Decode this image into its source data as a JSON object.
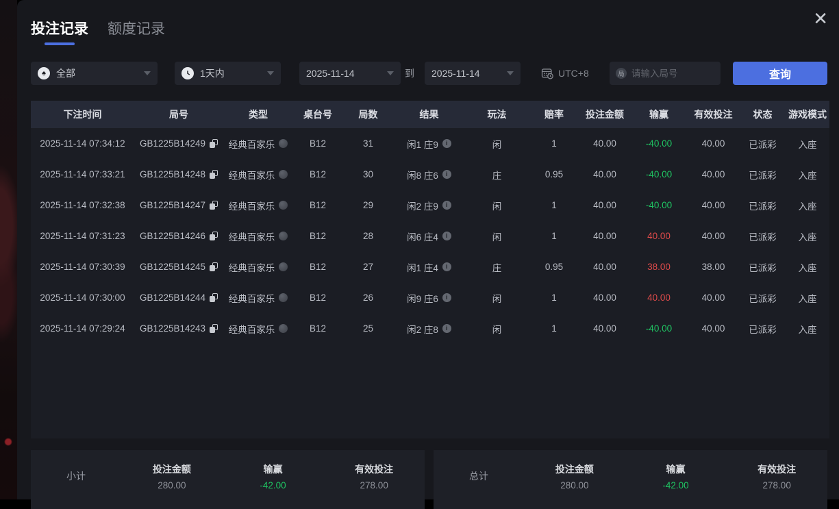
{
  "icons": {
    "close": "✕",
    "round_input_char": "局"
  },
  "colors": {
    "accent_blue": "#4c6fe0",
    "positive_red": "#e04b4b",
    "negative_green": "#1fc462"
  },
  "tabs": [
    {
      "label": "投注记录",
      "active": true
    },
    {
      "label": "额度记录",
      "active": false
    }
  ],
  "filters": {
    "game_type_value": "全部",
    "time_range_value": "1天内",
    "date_from": "2025-11-14",
    "to_label": "到",
    "date_to": "2025-11-14",
    "timezone": "UTC+8",
    "round_input_placeholder": "请输入局号",
    "query_button_label": "查询"
  },
  "table": {
    "headers": [
      "下注时间",
      "局号",
      "类型",
      "桌台号",
      "局数",
      "结果",
      "玩法",
      "赔率",
      "投注金额",
      "输赢",
      "有效投注",
      "状态",
      "游戏模式"
    ],
    "rows": [
      {
        "time": "2025-11-14 07:34:12",
        "round_id": "GB1225B14249",
        "type": "经典百家乐",
        "table_no": "B12",
        "round_no": "31",
        "result": "闲1 庄9",
        "play": "闲",
        "odds": "1",
        "bet": "40.00",
        "win_loss": "-40.00",
        "win_loss_color": "green",
        "valid_bet": "40.00",
        "status": "已派彩",
        "mode": "入座"
      },
      {
        "time": "2025-11-14 07:33:21",
        "round_id": "GB1225B14248",
        "type": "经典百家乐",
        "table_no": "B12",
        "round_no": "30",
        "result": "闲8 庄6",
        "play": "庄",
        "odds": "0.95",
        "bet": "40.00",
        "win_loss": "-40.00",
        "win_loss_color": "green",
        "valid_bet": "40.00",
        "status": "已派彩",
        "mode": "入座"
      },
      {
        "time": "2025-11-14 07:32:38",
        "round_id": "GB1225B14247",
        "type": "经典百家乐",
        "table_no": "B12",
        "round_no": "29",
        "result": "闲2 庄9",
        "play": "闲",
        "odds": "1",
        "bet": "40.00",
        "win_loss": "-40.00",
        "win_loss_color": "green",
        "valid_bet": "40.00",
        "status": "已派彩",
        "mode": "入座"
      },
      {
        "time": "2025-11-14 07:31:23",
        "round_id": "GB1225B14246",
        "type": "经典百家乐",
        "table_no": "B12",
        "round_no": "28",
        "result": "闲6 庄4",
        "play": "闲",
        "odds": "1",
        "bet": "40.00",
        "win_loss": "40.00",
        "win_loss_color": "red",
        "valid_bet": "40.00",
        "status": "已派彩",
        "mode": "入座"
      },
      {
        "time": "2025-11-14 07:30:39",
        "round_id": "GB1225B14245",
        "type": "经典百家乐",
        "table_no": "B12",
        "round_no": "27",
        "result": "闲1 庄4",
        "play": "庄",
        "odds": "0.95",
        "bet": "40.00",
        "win_loss": "38.00",
        "win_loss_color": "red",
        "valid_bet": "38.00",
        "status": "已派彩",
        "mode": "入座"
      },
      {
        "time": "2025-11-14 07:30:00",
        "round_id": "GB1225B14244",
        "type": "经典百家乐",
        "table_no": "B12",
        "round_no": "26",
        "result": "闲9 庄6",
        "play": "闲",
        "odds": "1",
        "bet": "40.00",
        "win_loss": "40.00",
        "win_loss_color": "red",
        "valid_bet": "40.00",
        "status": "已派彩",
        "mode": "入座"
      },
      {
        "time": "2025-11-14 07:29:24",
        "round_id": "GB1225B14243",
        "type": "经典百家乐",
        "table_no": "B12",
        "round_no": "25",
        "result": "闲2 庄8",
        "play": "闲",
        "odds": "1",
        "bet": "40.00",
        "win_loss": "-40.00",
        "win_loss_color": "green",
        "valid_bet": "40.00",
        "status": "已派彩",
        "mode": "入座"
      }
    ]
  },
  "summary": {
    "col_bet": "投注金额",
    "col_win": "输赢",
    "col_valid": "有效投注",
    "subtotal": {
      "label": "小计",
      "bet": "280.00",
      "win": "-42.00",
      "valid": "278.00"
    },
    "total": {
      "label": "总计",
      "bet": "280.00",
      "win": "-42.00",
      "valid": "278.00"
    }
  }
}
